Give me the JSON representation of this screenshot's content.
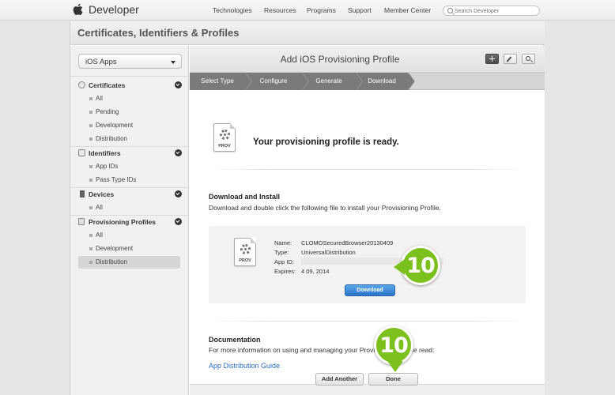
{
  "topnav": {
    "brand": "Developer",
    "links": [
      "Technologies",
      "Resources",
      "Programs",
      "Support",
      "Member Center"
    ],
    "search_placeholder": "Search Developer"
  },
  "page_title": "Certificates, Identifiers & Profiles",
  "sidebar": {
    "select_value": "iOS Apps",
    "sections": [
      {
        "label": "Certificates",
        "icon": "certificate-icon",
        "items": [
          "All",
          "Pending",
          "Development",
          "Distribution"
        ]
      },
      {
        "label": "Identifiers",
        "icon": "id-icon",
        "items": [
          "App IDs",
          "Pass Type IDs"
        ]
      },
      {
        "label": "Devices",
        "icon": "device-icon",
        "items": [
          "All"
        ]
      },
      {
        "label": "Provisioning Profiles",
        "icon": "profile-icon",
        "items": [
          "All",
          "Development",
          "Distribution"
        ]
      }
    ],
    "active_item": "Provisioning Profiles / Distribution"
  },
  "content": {
    "title": "Add iOS Provisioning Profile",
    "toolbar_icons": [
      "plus-icon",
      "edit-icon",
      "search-icon"
    ],
    "steps": [
      "Select Type",
      "Configure",
      "Generate",
      "Download"
    ],
    "ready_text": "Your provisioning profile is ready.",
    "doc_tag": "PROV",
    "download_heading": "Download and Install",
    "download_desc": "Download and double click the following file to install your Provisioning Profile.",
    "profile": {
      "name_key": "Name:",
      "name_val": "CLOMOSecuredBrowser20130409",
      "type_key": "Type:",
      "type_val": "UniversalDistribution",
      "appid_key": "App ID:",
      "appid_val": "",
      "expires_key": "Expires:",
      "expires_val": "4 09, 2014"
    },
    "download_button": "Download",
    "documentation_heading": "Documentation",
    "documentation_desc": "For more information on using and managing your Provisioning Profile read:",
    "doc_link": "App Distribution Guide",
    "add_another_button": "Add Another",
    "done_button": "Done"
  },
  "callouts": [
    "10",
    "10"
  ],
  "colors": {
    "callout": "#7cc01e",
    "step_active": "#7a7a7a",
    "download_button": "#2c74c9",
    "link": "#2a6ec4"
  }
}
